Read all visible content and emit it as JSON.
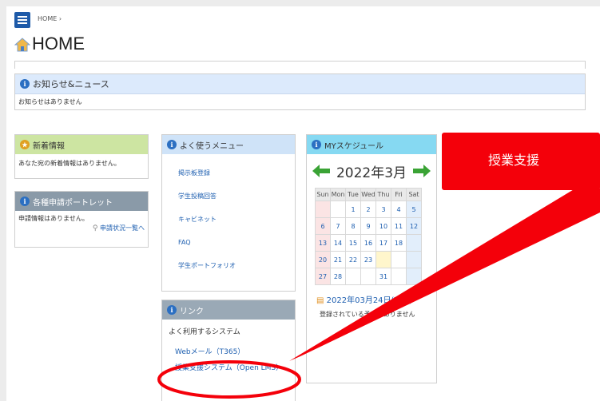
{
  "header": {
    "breadcrumb": "HOME ›",
    "title": "HOME"
  },
  "news": {
    "title": "お知らせ&ニュース",
    "body": "お知らせはありません"
  },
  "new_info": {
    "title": "新着情報",
    "body": "あなた宛の新着情報はありません。"
  },
  "requests": {
    "title": "各種申請ポートレット",
    "body": "申請情報はありません。",
    "link": "申請状況一覧へ"
  },
  "menu": {
    "title": "よく使うメニュー",
    "items": [
      "掲示板登録",
      "学生投稿回答",
      "キャビネット",
      "FAQ",
      "学生ポートフォリオ"
    ]
  },
  "links": {
    "title": "リンク",
    "subtitle": "よく利用するシステム",
    "items": [
      "Webメール（T365）",
      "授業支援システム（Open LMS）"
    ]
  },
  "schedule": {
    "title": "MYスケジュール",
    "month": "2022年3月",
    "weekdays": [
      "Sun",
      "Mon",
      "Tue",
      "Wed",
      "Thu",
      "Fri",
      "Sat"
    ],
    "weeks": [
      [
        "",
        "",
        "1",
        "2",
        "3",
        "4",
        "5"
      ],
      [
        "6",
        "7",
        "8",
        "9",
        "10",
        "11",
        "12"
      ],
      [
        "13",
        "14",
        "15",
        "16",
        "17",
        "18",
        ""
      ],
      [
        "20",
        "21",
        "22",
        "23",
        "",
        "",
        ""
      ],
      [
        "27",
        "28",
        "",
        "",
        "31",
        "",
        ""
      ]
    ],
    "selected_date": "2022年03月24日(Thu)",
    "no_events": "登録されている予定はありません"
  },
  "annotation": {
    "callout_text": "授業支援"
  },
  "colors": {
    "accent_blue": "#1e5aa8",
    "callout_red": "#f4000a",
    "link_blue": "#1e5fb0"
  }
}
